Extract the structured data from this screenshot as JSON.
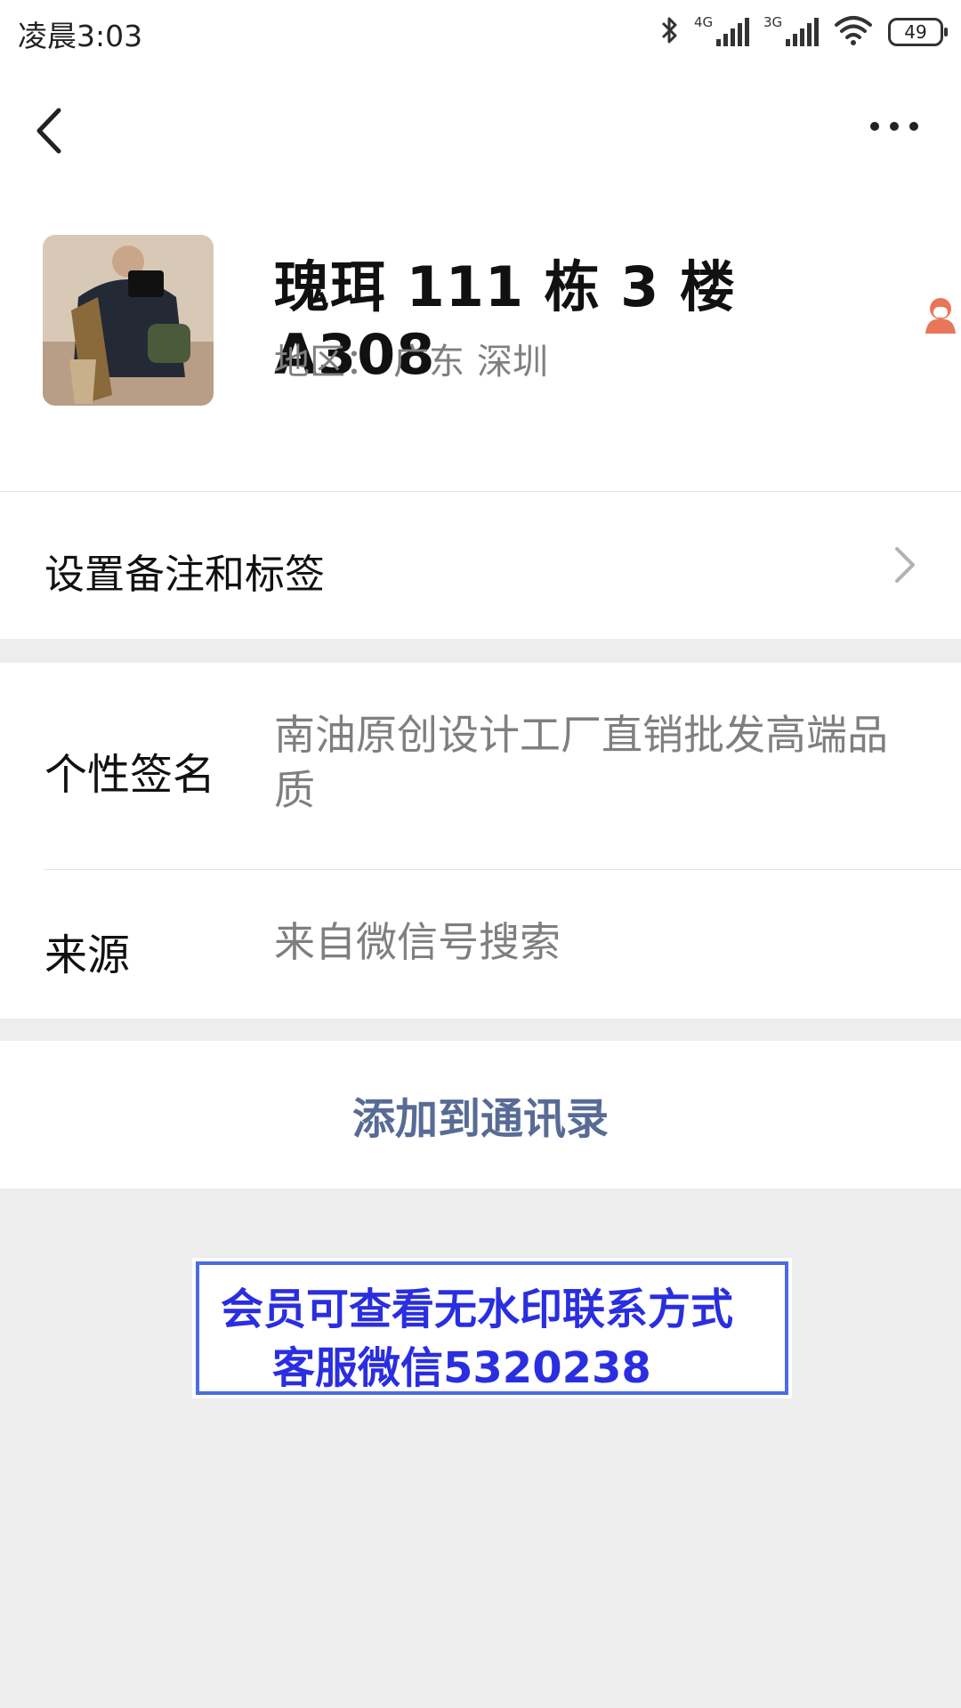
{
  "status_bar": {
    "time": "凌晨3:03",
    "network1": "4G",
    "network2": "3G",
    "battery": "49"
  },
  "profile": {
    "name": "瑰珥 111 栋 3 楼 A308",
    "region_label": "地区：",
    "region_province": "广东",
    "region_city": "深圳",
    "gender": "female",
    "gender_color": "#e8765a"
  },
  "remark_row": {
    "label": "设置备注和标签"
  },
  "info": {
    "signature_label": "个性签名",
    "signature_value": "南油原创设计工厂直销批发高端品质",
    "source_label": "来源",
    "source_value": "来自微信号搜索"
  },
  "add_contact": {
    "label": "添加到通讯录",
    "color": "#576b95"
  },
  "watermark": {
    "line1": "会员可查看无水印联系方式",
    "line2": "客服微信5320238",
    "color": "#2a2ee0"
  }
}
